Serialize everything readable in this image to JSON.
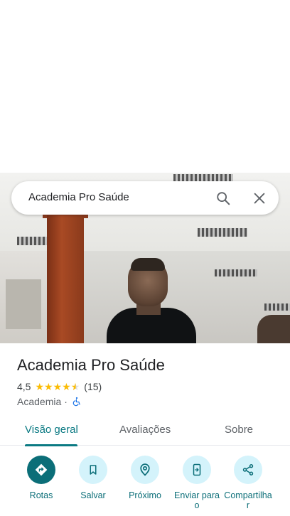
{
  "search": {
    "query": "Academia Pro Saúde"
  },
  "place": {
    "name": "Academia Pro Saúde",
    "rating": "4,5",
    "rating_value": 4.5,
    "review_count": "(15)",
    "category": "Academia",
    "separator": "·"
  },
  "tabs": [
    {
      "label": "Visão geral",
      "active": true
    },
    {
      "label": "Avaliações",
      "active": false
    },
    {
      "label": "Sobre",
      "active": false
    }
  ],
  "actions": [
    {
      "label": "Rotas",
      "icon": "directions-icon"
    },
    {
      "label": "Salvar",
      "icon": "bookmark-icon"
    },
    {
      "label": "Próximo",
      "icon": "nearby-icon"
    },
    {
      "label": "Enviar para o",
      "icon": "send-to-phone-icon"
    },
    {
      "label": "Compartilha r",
      "icon": "share-icon"
    }
  ],
  "colors": {
    "accent": "#0b6e78",
    "action_bg": "#d4f3fb",
    "star": "#fbbc04",
    "accessibility": "#1a73e8"
  }
}
